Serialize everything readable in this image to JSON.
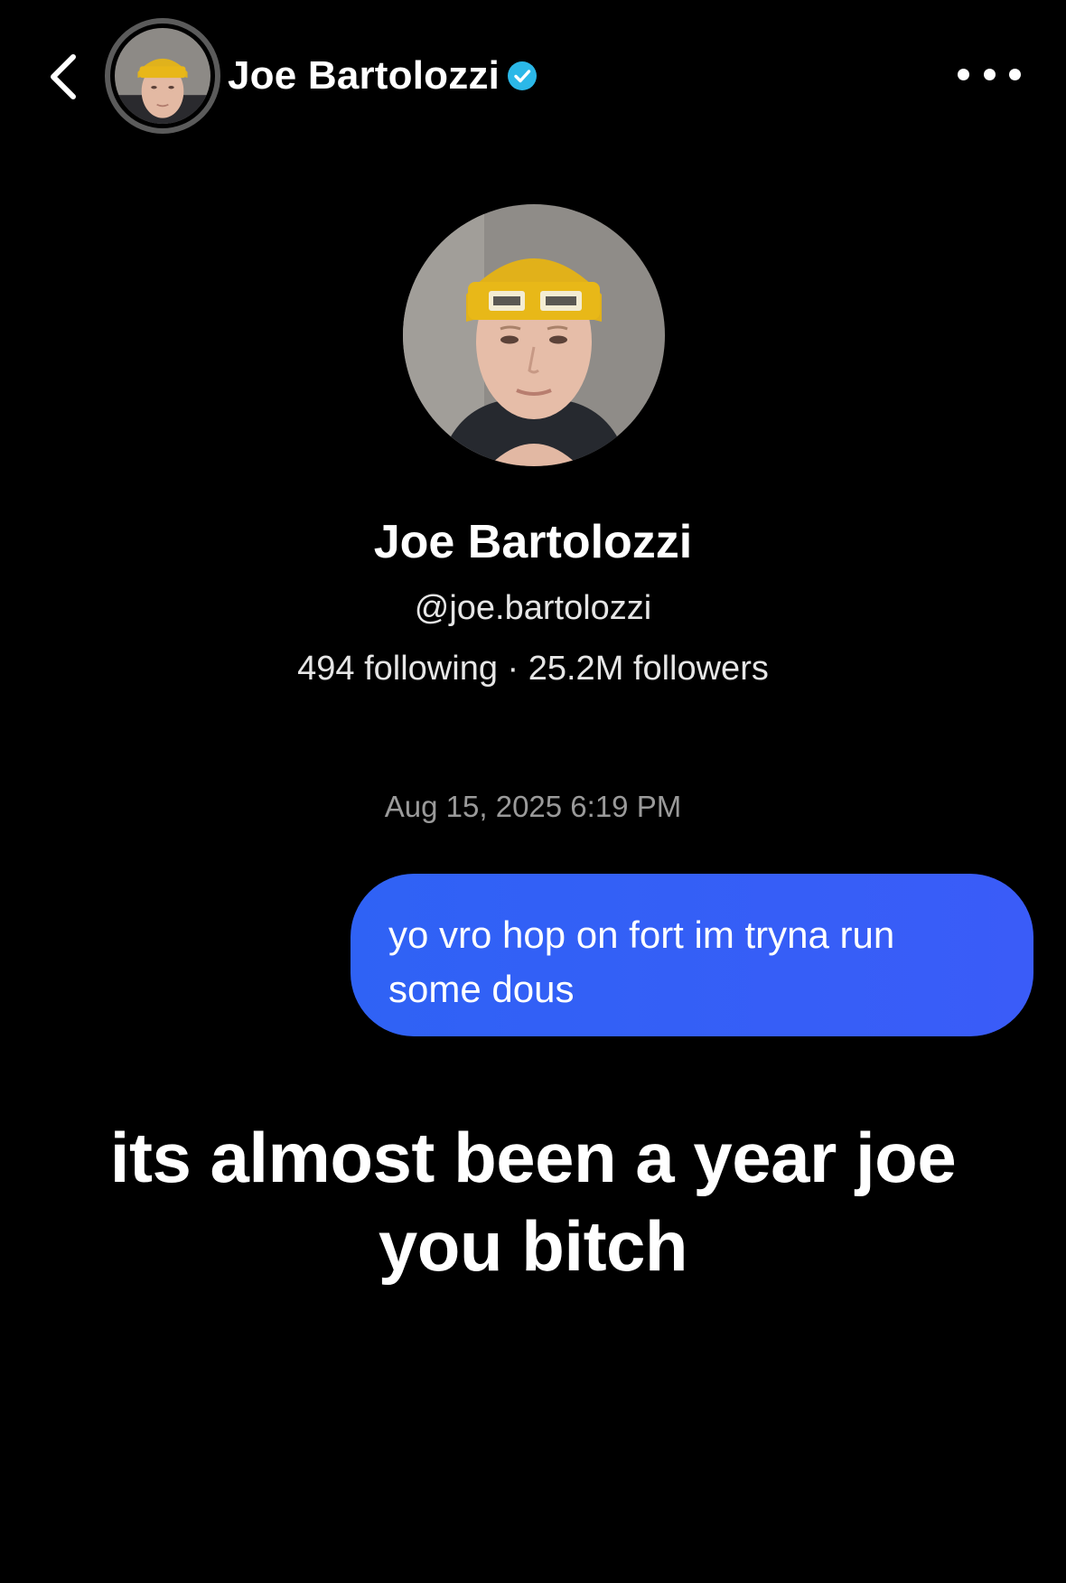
{
  "header": {
    "contact_name": "Joe Bartolozzi",
    "back_icon": "chevron-left-icon",
    "verified_icon": "verified-badge-icon",
    "more_icon": "more-horizontal-icon",
    "verified_color": "#2bb8e8"
  },
  "profile": {
    "name": "Joe Bartolozzi",
    "handle": "@joe.bartolozzi",
    "stats": "494 following · 25.2M followers"
  },
  "conversation": {
    "timestamp": "Aug 15, 2025 6:19 PM",
    "messages": [
      {
        "sender": "me",
        "text": "yo vro hop on fort im tryna run some dous",
        "bubble_color": "#3460f6"
      }
    ]
  },
  "overlay": {
    "caption": "its almost been a year joe you bitch"
  }
}
